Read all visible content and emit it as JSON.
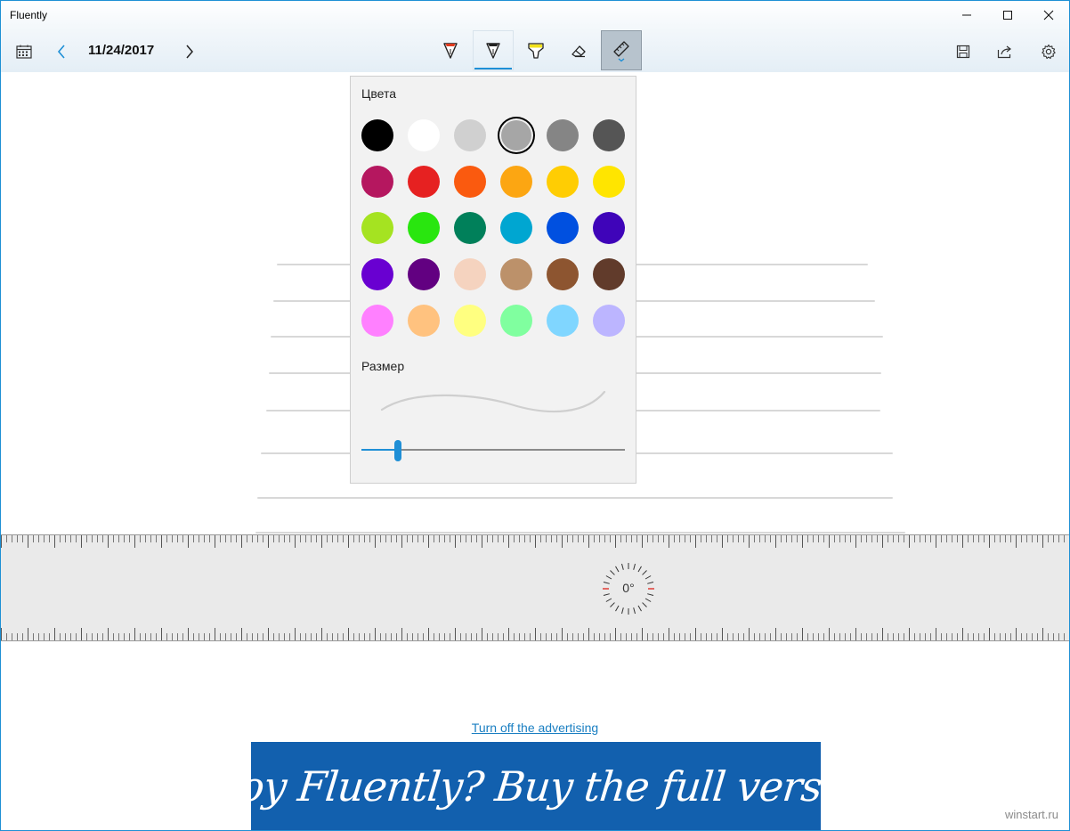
{
  "window": {
    "title": "Fluently"
  },
  "toolbar": {
    "date": "11/24/2017",
    "icons": {
      "calendar": "calendar-icon",
      "prev": "chevron-left-icon",
      "next": "chevron-right-icon",
      "pen_red": "pen-icon",
      "pen_black": "pen-icon",
      "highlighter": "highlighter-icon",
      "eraser": "eraser-icon",
      "ruler": "ruler-icon",
      "save": "save-icon",
      "share": "share-icon",
      "settings": "gear-icon"
    }
  },
  "palette": {
    "colors_label": "Цвета",
    "size_label": "Размер",
    "size_value": 0.14,
    "selected_index": 3,
    "colors": [
      "#000000",
      "#ffffff",
      "#d0d0d0",
      "#a6a6a6",
      "#858585",
      "#555555",
      "#b5175f",
      "#e62121",
      "#fa5a0f",
      "#fca612",
      "#ffcd03",
      "#ffe500",
      "#a5e321",
      "#29e60f",
      "#00805a",
      "#00a6d1",
      "#0050e0",
      "#3f04b9",
      "#6900d1",
      "#620081",
      "#f5d3bf",
      "#bc916a",
      "#8d5530",
      "#613b2b",
      "#ff80ff",
      "#ffc27f",
      "#ffff80",
      "#80ff9f",
      "#80d6ff",
      "#bcb5ff"
    ]
  },
  "ruler": {
    "angle": "0°"
  },
  "ad": {
    "link_text": "Turn off the advertising",
    "banner_text": "Enjoy Fluently? Buy the full version!"
  },
  "watermark": "winstart.ru",
  "colors": {
    "accent": "#1e8fd6",
    "banner": "#1260ae"
  }
}
